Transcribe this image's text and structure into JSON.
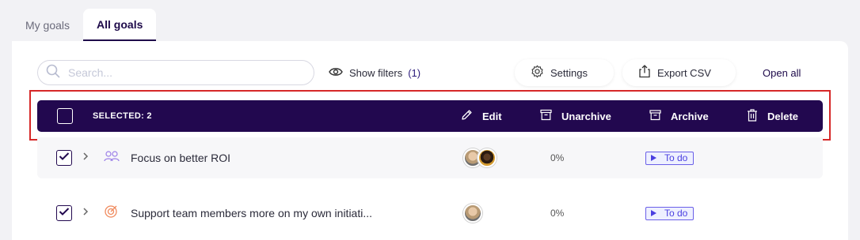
{
  "tabs": [
    {
      "label": "My goals",
      "active": false
    },
    {
      "label": "All goals",
      "active": true
    }
  ],
  "search": {
    "placeholder": "Search..."
  },
  "toolbar": {
    "show_filters_label": "Show filters",
    "filters_count": "(1)",
    "settings_label": "Settings",
    "export_label": "Export CSV",
    "open_all_label": "Open all"
  },
  "selection_bar": {
    "selected_label": "SELECTED: 2",
    "edit_label": "Edit",
    "unarchive_label": "Unarchive",
    "archive_label": "Archive",
    "delete_label": "Delete"
  },
  "goals": [
    {
      "title": "Focus on better ROI",
      "icon": "group-icon",
      "progress": "0%",
      "status": "To do",
      "checked": true
    },
    {
      "title": "Support team members more on my own initiati...",
      "icon": "target-icon",
      "progress": "0%",
      "status": "To do",
      "checked": true
    }
  ],
  "colors": {
    "accent": "#22084f",
    "highlight": "#d62828",
    "status": "#4a3fe0"
  }
}
